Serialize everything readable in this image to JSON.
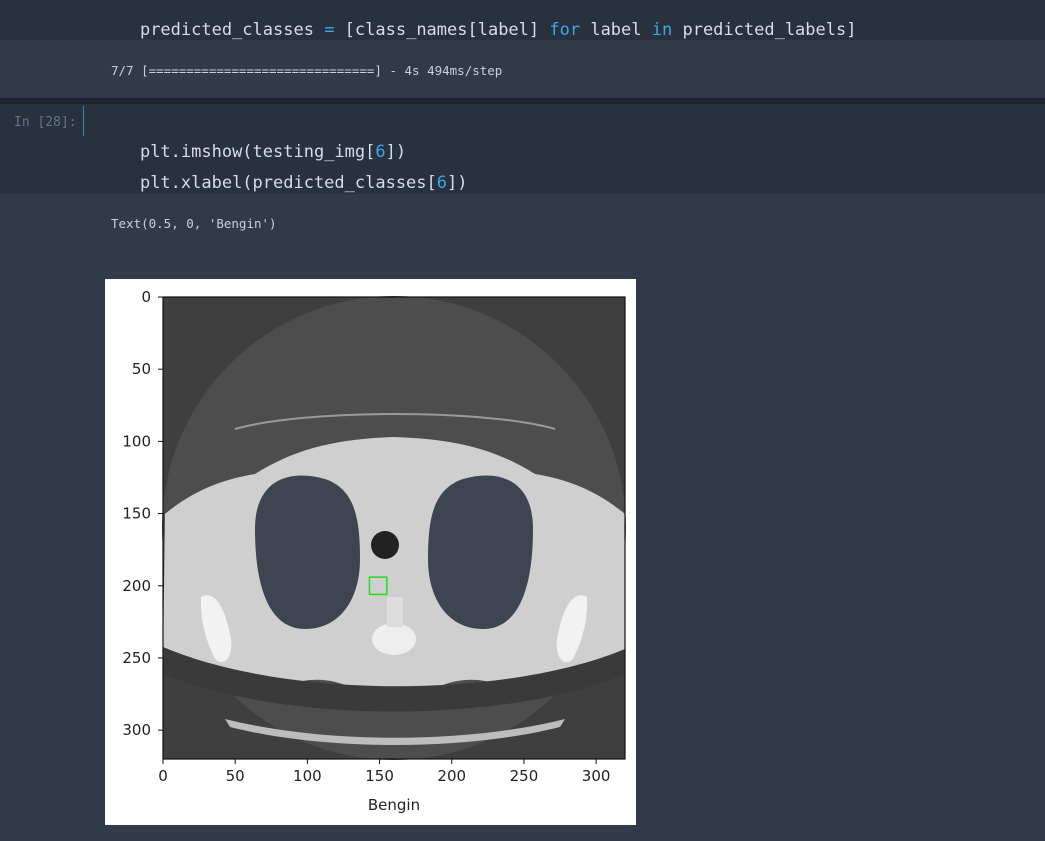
{
  "cells": [
    {
      "code_lines": [
        [
          "predicted_classes ",
          "= ",
          "[class_names[label] ",
          "for ",
          "label ",
          "in ",
          "predicted_labels]"
        ]
      ]
    },
    {
      "output": "7/7 [==============================] - 4s 494ms/step"
    },
    {
      "prompt": "In [28]:",
      "code_lines": [
        [
          "plt.imshow(testing_img[",
          "6",
          "])"
        ],
        [
          "plt.xlabel(predicted_classes[",
          "6",
          "])"
        ]
      ]
    },
    {
      "output": "Text(0.5, 0, 'Bengin')"
    }
  ],
  "colors": {
    "background": "#323948",
    "input_cell": "#29313d",
    "keyword": "#3aa7e8",
    "bbox": "#22dd22"
  },
  "chart_data": {
    "type": "image",
    "xlabel": "Bengin",
    "ylabel": "",
    "x_ticks": [
      0,
      50,
      100,
      150,
      200,
      250,
      300
    ],
    "y_ticks": [
      0,
      50,
      100,
      150,
      200,
      250,
      300
    ],
    "xlim": [
      0,
      320
    ],
    "ylim": [
      320,
      0
    ],
    "annotations": [
      {
        "type": "rectangle",
        "x": [
          143,
          155
        ],
        "y": [
          194,
          206
        ],
        "color": "#22dd22"
      }
    ]
  }
}
